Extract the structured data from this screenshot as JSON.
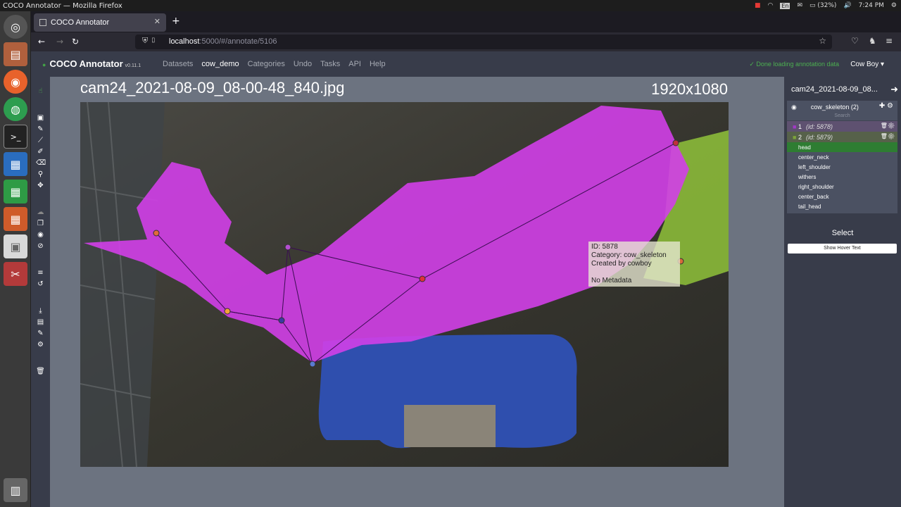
{
  "os": {
    "window_title": "COCO Annotator — Mozilla Firefox",
    "keyboard": "En",
    "battery": "(32%)",
    "time": "7:24 PM"
  },
  "browser": {
    "tab_title": "COCO Annotator",
    "url_host": "localhost",
    "url_path": ":5000/#/annotate/5106"
  },
  "app": {
    "brand": "COCO Annotator",
    "version": "v0.11.1",
    "menu": [
      "Datasets",
      "cow_demo",
      "Categories",
      "Undo",
      "Tasks",
      "API",
      "Help"
    ],
    "status": "✓ Done loading annotation data",
    "user": "Cow Boy ▾"
  },
  "image": {
    "filename": "cam24_2021-08-09_08-00-48_840.jpg",
    "dimensions": "1920x1080"
  },
  "hover": {
    "id_line": "ID: 5878",
    "category_line": "Category: cow_skeleton",
    "created_line": "Created by cowboy",
    "metadata_line": "No Metadata"
  },
  "sidebar": {
    "title": "cam24_2021-08-09_08...",
    "category": "cow_skeleton (2)",
    "search_placeholder": "Search",
    "annotations": [
      {
        "num": "1",
        "id": "(id: 5878)",
        "color": "#a23ac6"
      },
      {
        "num": "2",
        "id": "(id: 5879)",
        "color": "#7da33a"
      }
    ],
    "keypoints": [
      "head",
      "center_neck",
      "left_shoulder",
      "withers",
      "right_shoulder",
      "center_back",
      "tail_head"
    ],
    "mode_label": "Select",
    "hover_button": "Show Hover Text"
  },
  "colors": {
    "purple_mask": "#d13fe8",
    "green_mask": "#8fc23a",
    "sidebar_bg": "#383c4a",
    "canvas_bg": "#6c7380"
  }
}
